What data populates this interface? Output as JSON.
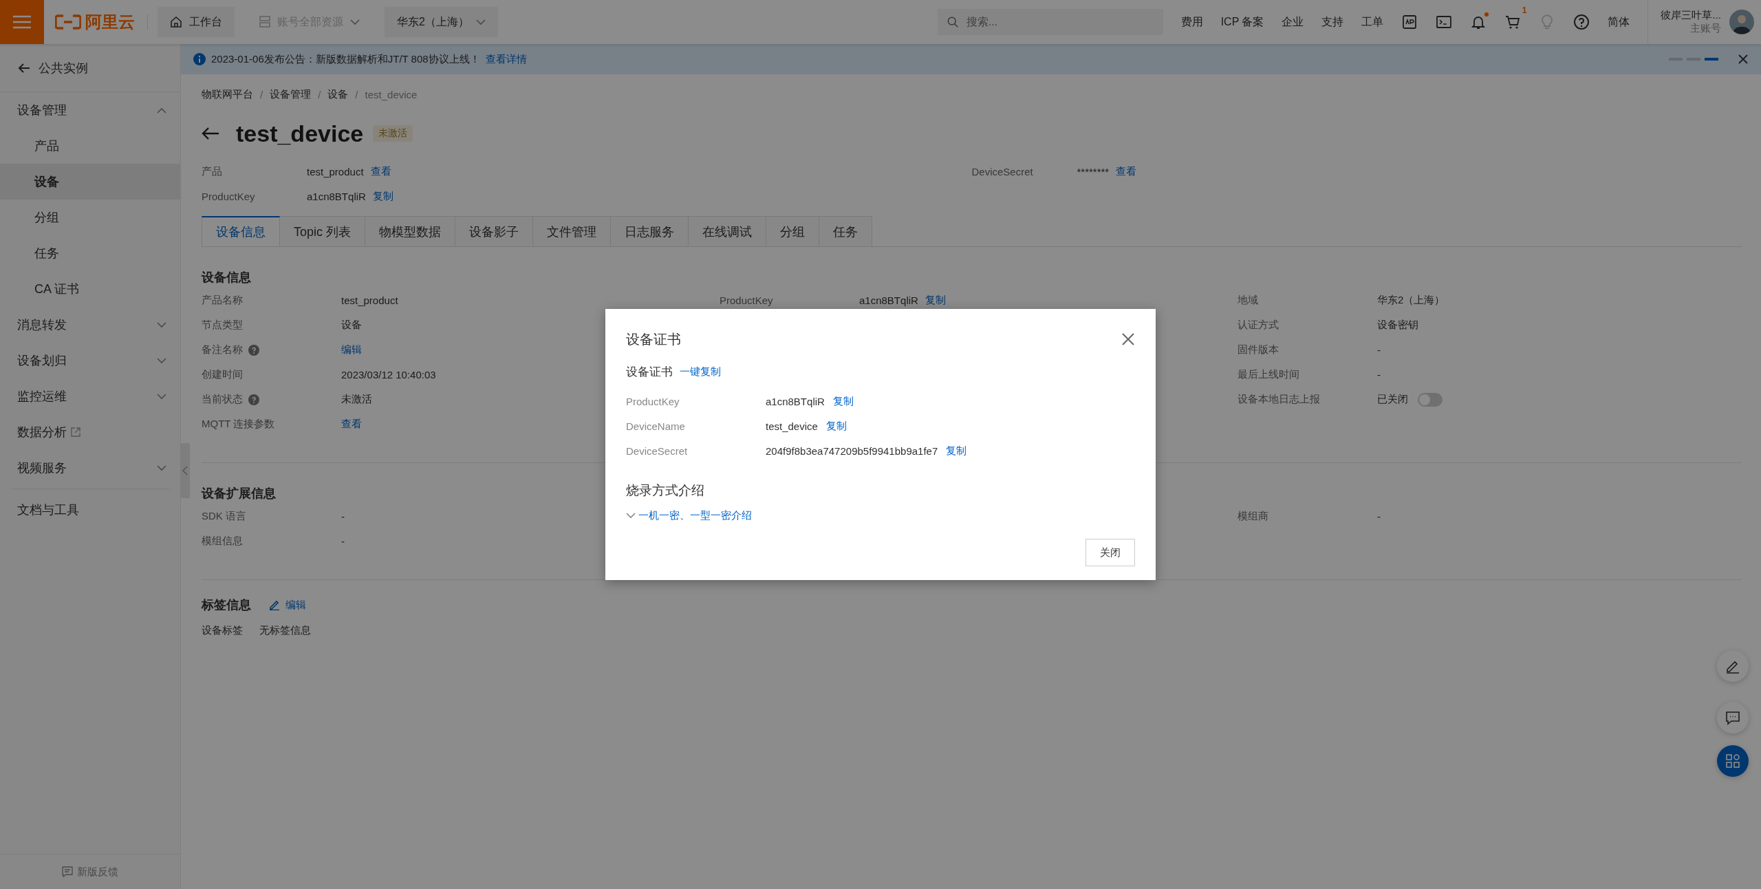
{
  "topbar": {
    "brand": "阿里云",
    "workbench": "工作台",
    "resources": {
      "label": "账号全部资源",
      "disabled": true
    },
    "region": "华东2（上海）",
    "search": {
      "placeholder": "搜索..."
    },
    "links": [
      "费用",
      "ICP 备案",
      "企业",
      "支持",
      "工单"
    ],
    "icons": [
      {
        "kind": "app"
      },
      {
        "kind": "terminal"
      },
      {
        "kind": "bell",
        "dot": true
      },
      {
        "kind": "cart",
        "badge": "1"
      },
      {
        "kind": "bulb",
        "disabled": true
      },
      {
        "kind": "help"
      }
    ],
    "language": "简体",
    "user": {
      "name": "彼岸三叶草...",
      "role": "主账号"
    }
  },
  "announcement": {
    "text": "2023-01-06发布公告：新版数据解析和JT/T 808协议上线！",
    "link": "查看详情",
    "pager": [
      {
        "selected": false
      },
      {
        "selected": false
      },
      {
        "selected": true
      }
    ]
  },
  "sidebar": {
    "back": "公共实例",
    "items": [
      {
        "label": "设备管理",
        "kind": "group",
        "expanded": true,
        "children": [
          {
            "label": "产品",
            "selected": false
          },
          {
            "label": "设备",
            "selected": true
          },
          {
            "label": "分组",
            "selected": false
          },
          {
            "label": "任务",
            "selected": false
          },
          {
            "label": "CA 证书",
            "selected": false
          }
        ]
      },
      {
        "label": "消息转发",
        "kind": "group",
        "expanded": false
      },
      {
        "label": "设备划归",
        "kind": "group",
        "expanded": false
      },
      {
        "label": "监控运维",
        "kind": "group",
        "expanded": false
      },
      {
        "label": "数据分析",
        "kind": "external"
      },
      {
        "label": "视频服务",
        "kind": "group",
        "expanded": false
      }
    ],
    "docs": "文档与工具",
    "feedback": "新版反馈"
  },
  "breadcrumb": {
    "separator": "/",
    "items": [
      "物联网平台",
      "设备管理",
      "设备",
      "test_device"
    ]
  },
  "title": "test_device",
  "status_badge": "未激活",
  "summary": {
    "left": [
      {
        "label": "产品",
        "value": "test_product",
        "action": "查看"
      },
      {
        "label": "ProductKey",
        "value": "a1cn8BTqliR",
        "action": "复制"
      }
    ],
    "right": [
      {
        "label": "DeviceSecret",
        "value": "********",
        "action": "查看"
      }
    ]
  },
  "tabs": [
    {
      "label": "设备信息",
      "selected": true
    },
    {
      "label": "Topic 列表",
      "selected": false
    },
    {
      "label": "物模型数据",
      "selected": false
    },
    {
      "label": "设备影子",
      "selected": false
    },
    {
      "label": "文件管理",
      "selected": false
    },
    {
      "label": "日志服务",
      "selected": false
    },
    {
      "label": "在线调试",
      "selected": false
    },
    {
      "label": "分组",
      "selected": false
    },
    {
      "label": "任务",
      "selected": false
    }
  ],
  "sections": [
    {
      "title": "设备信息",
      "columns": [
        [
          {
            "label": "产品名称",
            "value": "test_product",
            "kind": "text"
          },
          {
            "label": "节点类型",
            "value": "设备",
            "kind": "text"
          },
          {
            "label": "备注名称",
            "help": true,
            "value": "编辑",
            "kind": "link"
          },
          {
            "label": "创建时间",
            "value": "2023/03/12 10:40:03",
            "kind": "text"
          },
          {
            "label": "当前状态",
            "help": true,
            "value": "未激活",
            "kind": "text"
          },
          {
            "label": "MQTT 连接参数",
            "value": "查看",
            "kind": "link"
          }
        ],
        [
          {
            "label": "ProductKey",
            "value": "a1cn8BTqliR",
            "kind": "text",
            "action": "复制"
          }
        ],
        [
          {
            "label": "地域",
            "value": "华东2（上海）",
            "kind": "text"
          },
          {
            "label": "认证方式",
            "value": "设备密钥",
            "kind": "text"
          },
          {
            "label": "固件版本",
            "value": "-",
            "kind": "text"
          },
          {
            "label": "最后上线时间",
            "value": "-",
            "kind": "text"
          },
          {
            "label": "设备本地日志上报",
            "value": "已关闭",
            "kind": "toggle",
            "on": false
          }
        ]
      ]
    },
    {
      "title": "设备扩展信息",
      "columns": [
        [
          {
            "label": "SDK 语言",
            "value": "-",
            "kind": "text"
          },
          {
            "label": "模组信息",
            "value": "-",
            "kind": "text"
          }
        ],
        [],
        [
          {
            "label": "模组商",
            "value": "-",
            "kind": "text"
          }
        ]
      ]
    }
  ],
  "tags": {
    "title": "标签信息",
    "edit": "编辑",
    "label": "设备标签",
    "value": "无标签信息"
  },
  "modal": {
    "title": "设备证书",
    "subtitle": "设备证书",
    "copy_all": "一键复制",
    "fields": [
      {
        "label": "ProductKey",
        "value": "a1cn8BTqliR",
        "action": "复制"
      },
      {
        "label": "DeviceName",
        "value": "test_device",
        "action": "复制"
      },
      {
        "label": "DeviceSecret",
        "value": "204f9f8b3ea747209b5f9941bb9a1fe7",
        "action": "复制"
      }
    ],
    "burn_title": "烧录方式介绍",
    "expander": {
      "label": "一机一密、一型一密介绍",
      "expanded": false
    },
    "close_button": "关闭"
  }
}
